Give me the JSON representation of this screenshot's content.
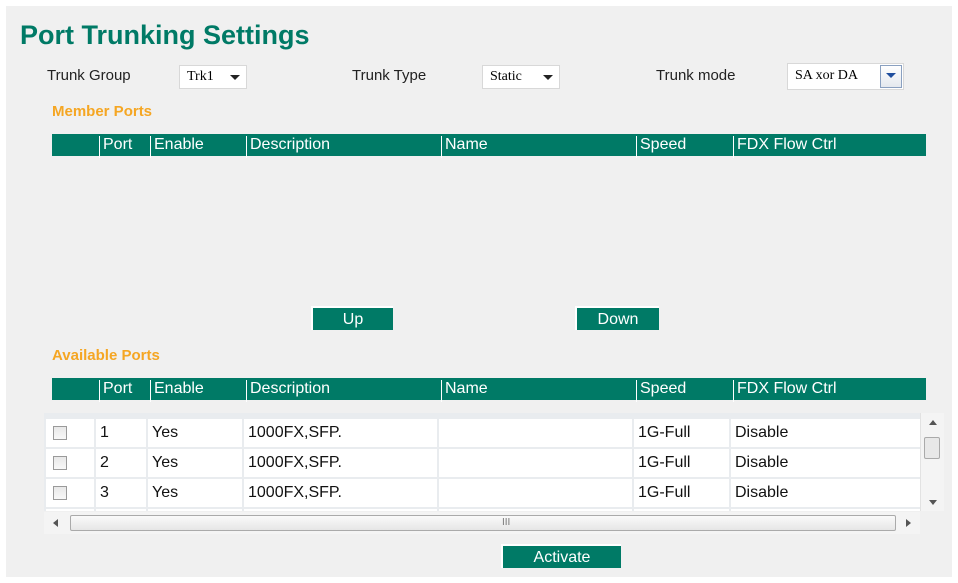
{
  "title": "Port Trunking Settings",
  "trunk_group": {
    "label": "Trunk Group",
    "value": "Trk1"
  },
  "trunk_type": {
    "label": "Trunk Type",
    "value": "Static"
  },
  "trunk_mode": {
    "label": "Trunk mode",
    "value": "SA xor DA"
  },
  "member_ports": {
    "heading": "Member Ports",
    "columns": [
      "Port",
      "Enable",
      "Description",
      "Name",
      "Speed",
      "FDX Flow Ctrl"
    ],
    "rows": []
  },
  "buttons": {
    "up": "Up",
    "down": "Down",
    "activate": "Activate"
  },
  "available_ports": {
    "heading": "Available Ports",
    "columns": [
      "Port",
      "Enable",
      "Description",
      "Name",
      "Speed",
      "FDX Flow Ctrl"
    ],
    "rows": [
      {
        "port": "1",
        "enable": "Yes",
        "description": "1000FX,SFP.",
        "name": "",
        "speed": "1G-Full",
        "fdx": "Disable",
        "checked": false
      },
      {
        "port": "2",
        "enable": "Yes",
        "description": "1000FX,SFP.",
        "name": "",
        "speed": "1G-Full",
        "fdx": "Disable",
        "checked": false
      },
      {
        "port": "3",
        "enable": "Yes",
        "description": "1000FX,SFP.",
        "name": "",
        "speed": "1G-Full",
        "fdx": "Disable",
        "checked": false
      }
    ]
  },
  "scrollbar": {
    "grip": "III"
  },
  "colors": {
    "accent": "#007a66",
    "section": "#f5a623"
  }
}
